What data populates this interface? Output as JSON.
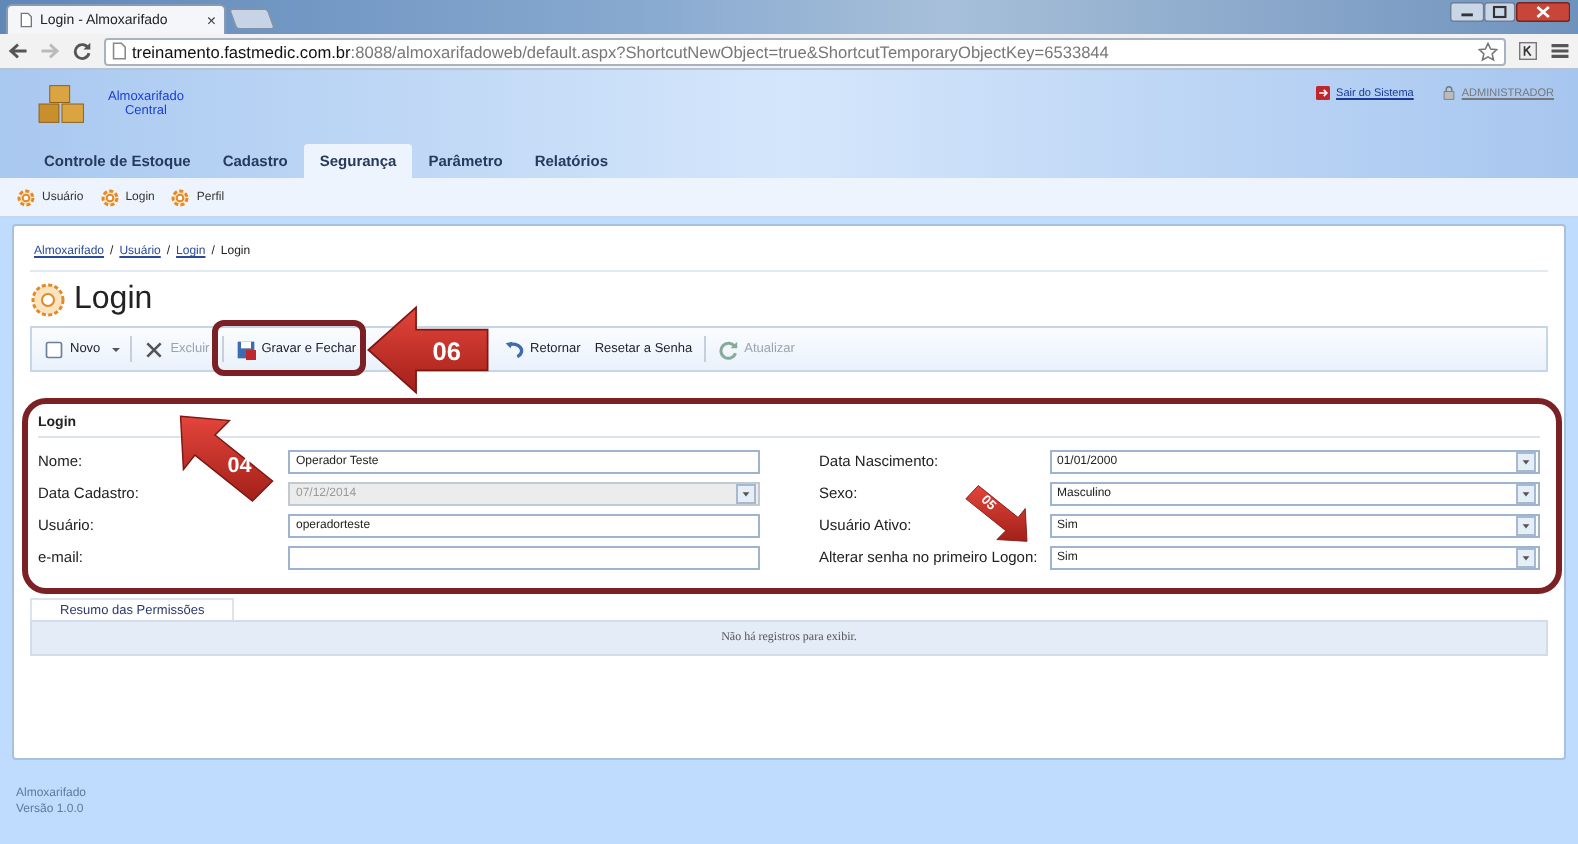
{
  "browser": {
    "tab_title": "Login - Almoxarifado",
    "tab_close": "×",
    "url_host": "treinamento.fastmedic.com.br",
    "url_rest": ":8088/almoxarifadoweb/default.aspx?ShortcutNewObject=true&ShortcutTemporaryObjectKey=6533844"
  },
  "header": {
    "app_name": "Almoxarifado",
    "app_sub": "Central",
    "links": [
      {
        "label": "Sair do Sistema",
        "kind": "exit"
      },
      {
        "label": "ADMINISTRADOR",
        "kind": "user"
      }
    ]
  },
  "menu_tabs": [
    {
      "label": "Controle de Estoque",
      "selected": false
    },
    {
      "label": "Cadastro",
      "selected": false
    },
    {
      "label": "Segurança",
      "selected": true
    },
    {
      "label": "Parâmetro",
      "selected": false
    },
    {
      "label": "Relatórios",
      "selected": false
    }
  ],
  "sub_menu": [
    "Usuário",
    "Login",
    "Perfil"
  ],
  "breadcrumb": {
    "links": [
      "Almoxarifado",
      "Usuário",
      "Login"
    ],
    "current": "Login",
    "separator": "/"
  },
  "page_title": "Login",
  "toolbar": [
    {
      "label": "Novo",
      "kind": "new",
      "disabled": false
    },
    {
      "label": "Excluir",
      "kind": "delete",
      "disabled": true
    },
    {
      "label": "Gravar e Fechar",
      "kind": "save",
      "disabled": false
    },
    {
      "label": "Retornar",
      "kind": "back",
      "disabled": false
    },
    {
      "label": "Resetar a Senha",
      "kind": "plain",
      "disabled": false
    },
    {
      "label": "Atualizar",
      "kind": "refresh",
      "disabled": true
    }
  ],
  "form": {
    "tab": "Login",
    "left": [
      {
        "label": "Nome:",
        "kind": "text",
        "value": "Operador Teste",
        "disabled": false
      },
      {
        "label": "Data Cadastro:",
        "kind": "combo",
        "value": "07/12/2014",
        "disabled": true
      },
      {
        "label": "Usuário:",
        "kind": "text",
        "value": "operadorteste",
        "disabled": false
      },
      {
        "label": "e-mail:",
        "kind": "text",
        "disabled": false
      }
    ],
    "right": [
      {
        "label": "Data Nascimento:",
        "kind": "combo",
        "value": "01/01/2000",
        "disabled": false
      },
      {
        "label": "Sexo:",
        "kind": "combo",
        "value": "Masculino",
        "disabled": false
      },
      {
        "label": "Usuário Ativo:",
        "kind": "combo",
        "value": "Sim",
        "disabled": false
      },
      {
        "label": "Alterar senha no primeiro Logon:",
        "kind": "combo",
        "value": "Sim",
        "disabled": false
      }
    ]
  },
  "permissions": {
    "tab": "Resumo das Permissões",
    "empty_text": "Não há registros para exibir."
  },
  "footer": [
    "Almoxarifado",
    "Versão 1.0.0"
  ],
  "callouts": [
    {
      "label": "06",
      "kind": "left"
    },
    {
      "label": "04",
      "kind": "up-left"
    },
    {
      "label": "05",
      "kind": "down-right"
    }
  ]
}
